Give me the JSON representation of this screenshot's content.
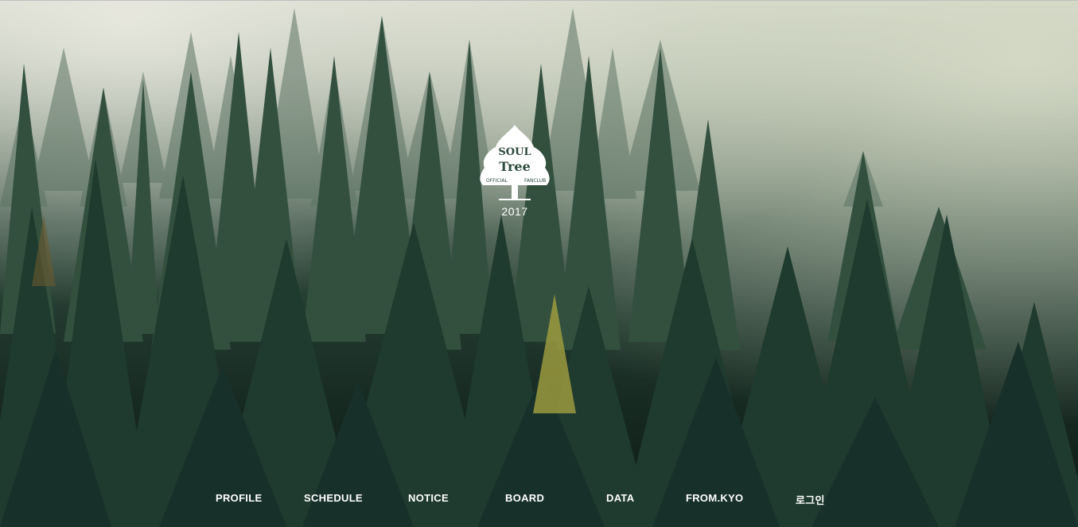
{
  "site": {
    "logo_icon": "tree-emblem-icon",
    "logo_text_main": "SOUL Tree",
    "logo_text_left": "OFFICIAL",
    "logo_text_right": "FANCLUB",
    "year": "2017"
  },
  "nav": {
    "items": [
      {
        "label": "PROFILE"
      },
      {
        "label": "SCHEDULE"
      },
      {
        "label": "NOTICE"
      },
      {
        "label": "BOARD"
      },
      {
        "label": "DATA"
      },
      {
        "label": "FROM.KYO"
      },
      {
        "label": "로그인"
      }
    ]
  },
  "colors": {
    "nav_text": "#ffffff",
    "forest_dark": "#15271f",
    "fog": "#d9dccf"
  }
}
